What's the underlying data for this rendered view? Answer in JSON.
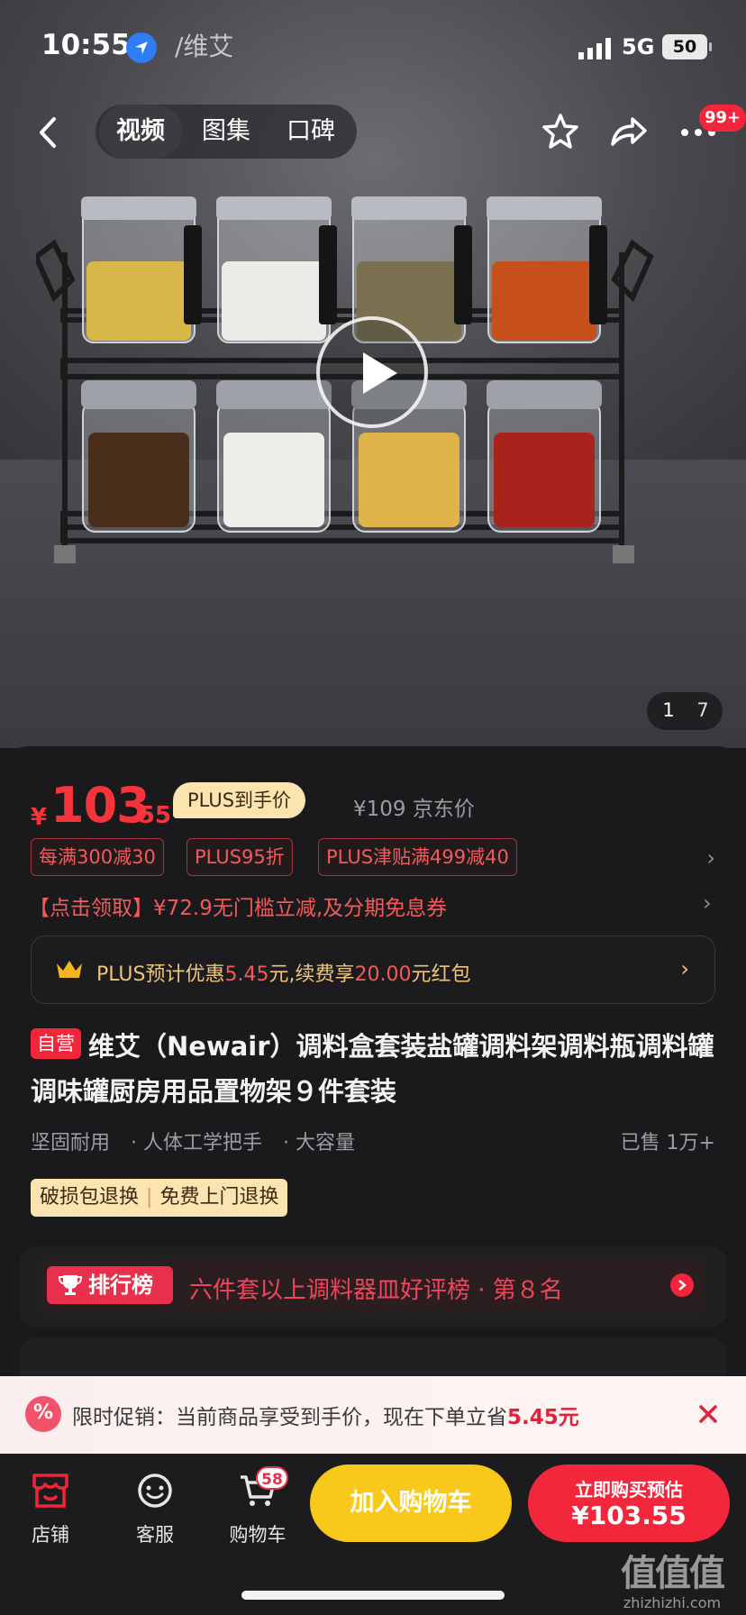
{
  "status_bar": {
    "time": "10:55",
    "brand_text": "/维艾",
    "network": "5G",
    "battery": "50"
  },
  "header": {
    "media_tabs": [
      {
        "label": "视频",
        "active": true
      },
      {
        "label": "图集",
        "active": false
      },
      {
        "label": "口碑",
        "active": false
      }
    ],
    "icons": [
      "back-icon",
      "star-icon",
      "share-icon",
      "more-icon"
    ],
    "message_badge": "99+"
  },
  "gallery": {
    "current_page": "1",
    "total_pages": "7"
  },
  "price": {
    "currency": "¥",
    "integer": "103",
    "decimal": ".55",
    "plus_tag": "PLUS到手价",
    "jd_price": "¥109 京东价"
  },
  "promotions": [
    "每满300减30",
    "PLUS95折",
    "PLUS津贴满499减40"
  ],
  "coupon_line": "【点击领取】¥72.9无门槛立减,及分期免息券",
  "plus_box": {
    "prefix": "PLUS预计优惠",
    "amount": "5.45",
    "middle": "元,续费享",
    "bonus": "20.00",
    "suffix": "元红包"
  },
  "product": {
    "self_tag": "自营",
    "title": "维艾（Newair）调料盒套装盐罐调料架调料瓶调料罐调味罐厨房用品置物架９件套装",
    "features": [
      "坚固耐用",
      "· 人体工学把手",
      "· 大容量"
    ],
    "sold": "已售 1万+",
    "service_tags": [
      "破损包退换",
      "免费上门退换"
    ]
  },
  "ranking": {
    "badge": "排行榜",
    "text": "六件套以上调料器皿好评榜 · 第８名"
  },
  "flash_sale": {
    "icon": "%",
    "text": "限时促销：当前商品享受到手价，现在下单立省",
    "amount": "5.45元"
  },
  "bottom_bar": {
    "store_label": "店铺",
    "service_label": "客服",
    "cart_label": "购物车",
    "cart_count": "58",
    "add_to_cart": "加入购物车",
    "buy_line1": "立即购买预估",
    "buy_line2": "¥103.55"
  },
  "watermark": {
    "big": "值值值",
    "small": "zhizhizhi.com"
  },
  "colors": {
    "accent_red": "#f2253a",
    "price_red": "#f8343b",
    "plus_gold": "#fbe4b0",
    "cart_yellow": "#f8c81a"
  }
}
